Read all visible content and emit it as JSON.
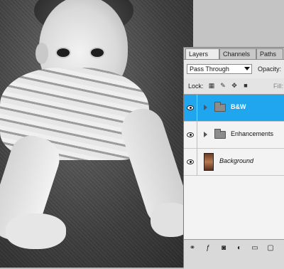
{
  "panel": {
    "tabs": [
      {
        "label": "Layers",
        "active": true
      },
      {
        "label": "Channels",
        "active": false
      },
      {
        "label": "Paths",
        "active": false
      }
    ],
    "blend_mode": "Pass Through",
    "opacity_label": "Opacity:",
    "lock_label": "Lock:",
    "fill_label": "Fill:",
    "layers": [
      {
        "name": "B&W",
        "type": "group",
        "selected": true,
        "visible": true
      },
      {
        "name": "Enhancements",
        "type": "group",
        "selected": false,
        "visible": true
      },
      {
        "name": "Background",
        "type": "image",
        "selected": false,
        "visible": true
      }
    ],
    "selection_color": "#1fa6ef"
  },
  "icons": {
    "lock_icons": [
      "lock-transparent-icon",
      "lock-brush-icon",
      "lock-move-icon",
      "lock-all-icon"
    ],
    "bottom_icons": [
      "link-layers-icon",
      "layer-style-icon",
      "layer-mask-icon",
      "adjustment-layer-icon",
      "new-group-icon",
      "new-layer-icon"
    ]
  }
}
